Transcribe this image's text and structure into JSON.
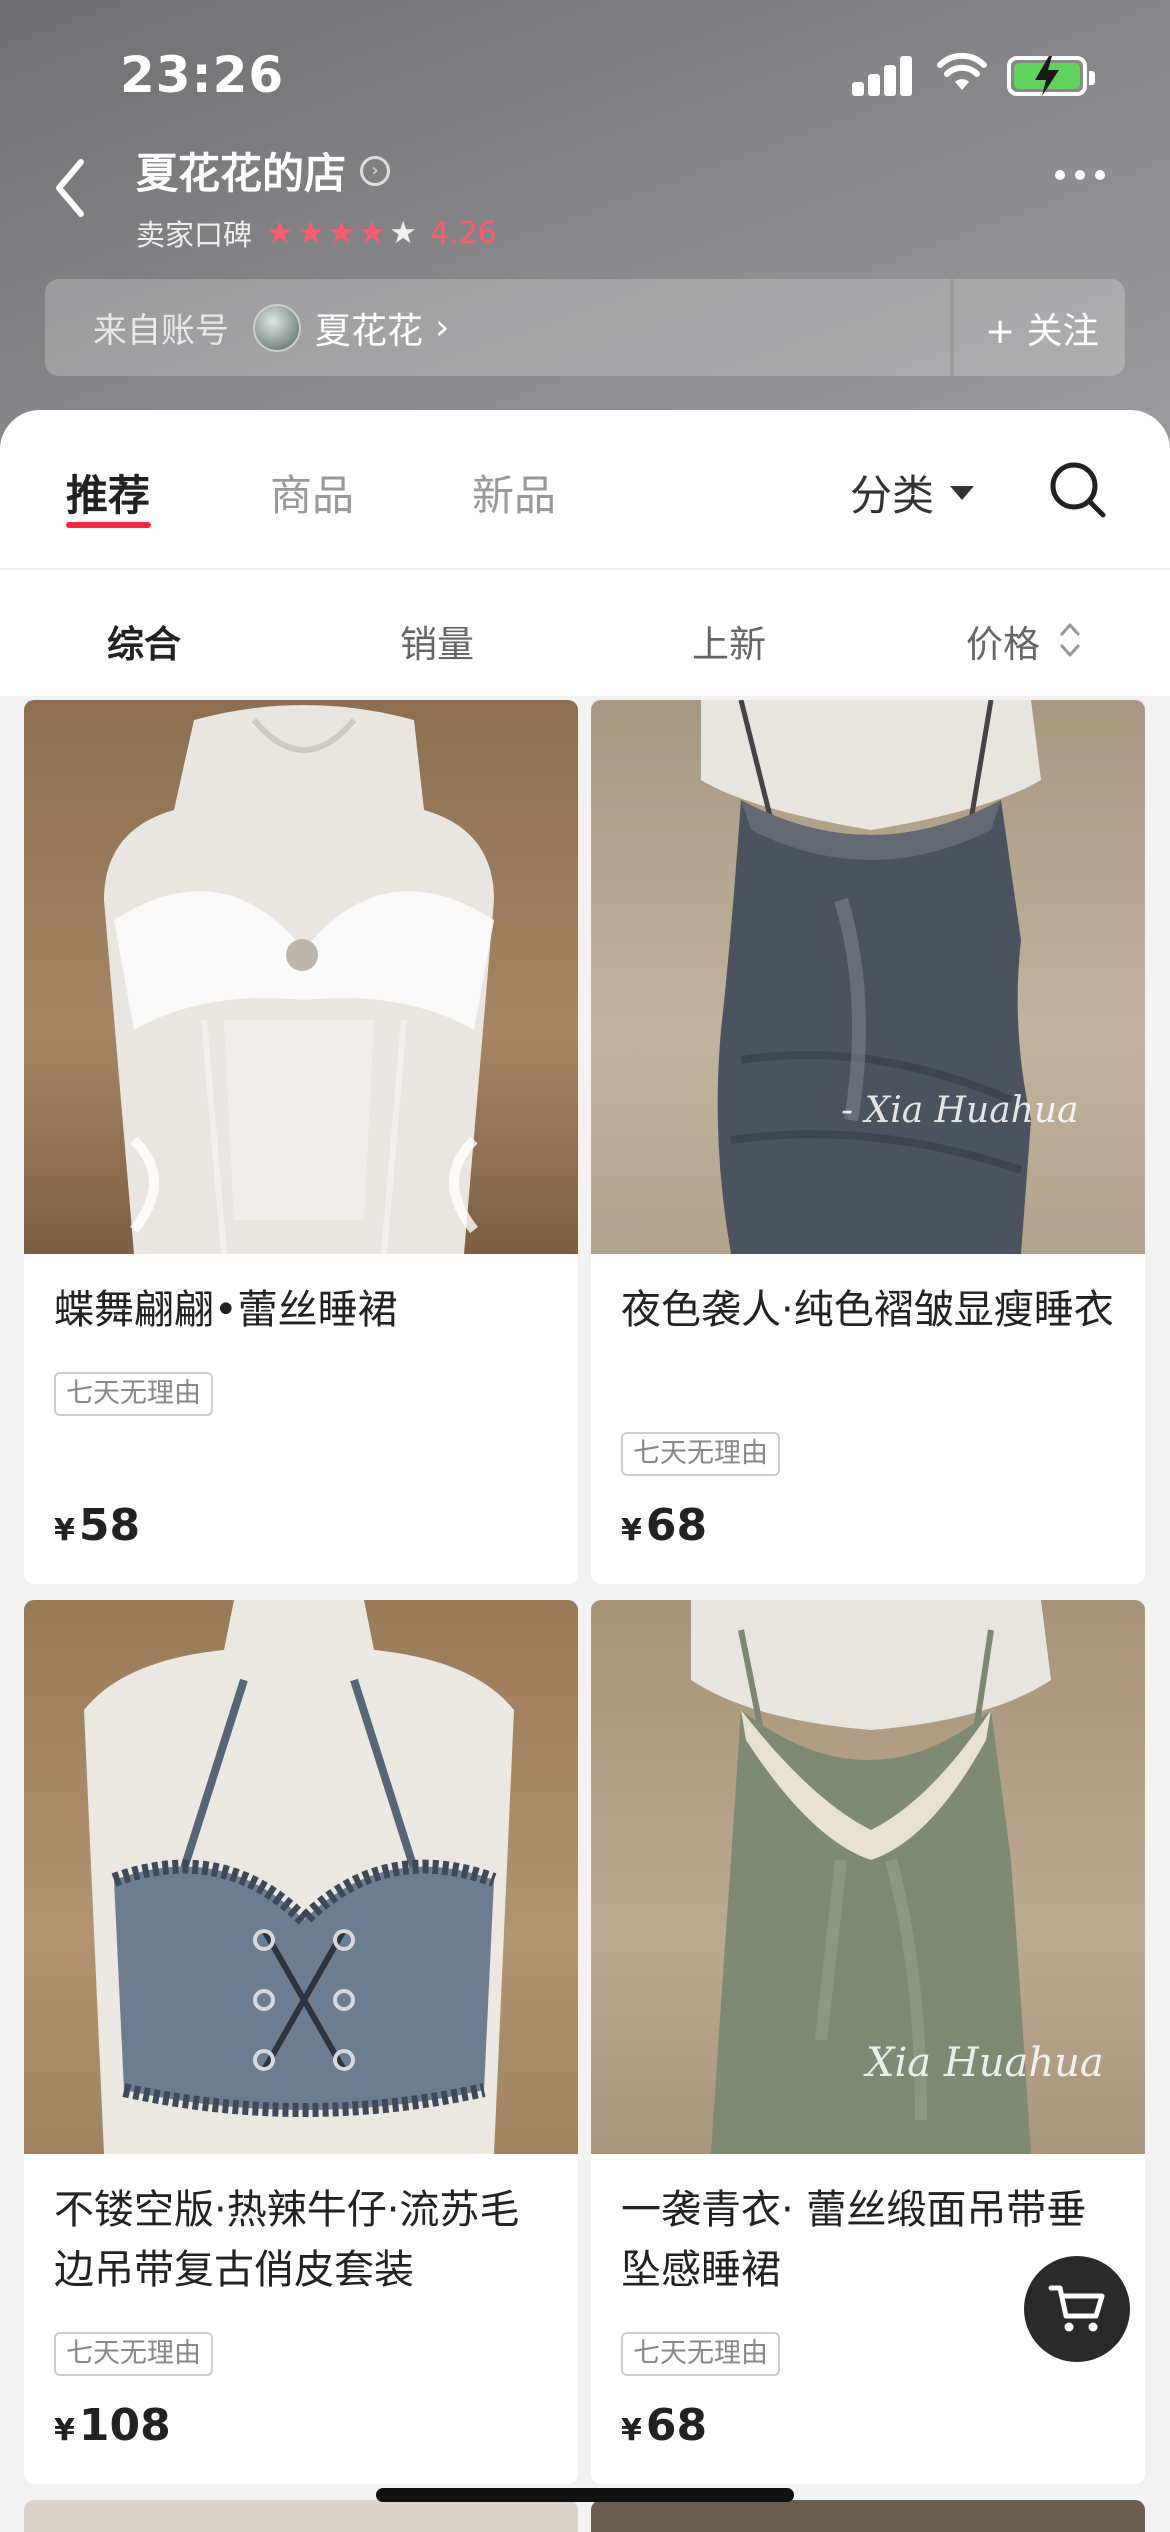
{
  "status_bar": {
    "time": "23:26"
  },
  "header": {
    "shop_name": "夏花花的店",
    "rating_label": "卖家口碑",
    "rating_score": "4.26",
    "rating_stars": 4.26,
    "account_from_label": "来自账号",
    "account_name": "夏花花",
    "follow_label": "+ 关注"
  },
  "tabs": [
    {
      "label": "推荐",
      "active": true
    },
    {
      "label": "商品",
      "active": false
    },
    {
      "label": "新品",
      "active": false
    }
  ],
  "category_label": "分类",
  "sort_options": [
    {
      "label": "综合",
      "active": true
    },
    {
      "label": "销量",
      "active": false
    },
    {
      "label": "上新",
      "active": false
    },
    {
      "label": "价格",
      "active": false
    }
  ],
  "products": [
    {
      "title": "蝶舞翩翩•蕾丝睡裙",
      "tag": "七天无理由",
      "currency": "¥",
      "price": "58"
    },
    {
      "title": "夜色袭人·纯色褶皱显瘦睡衣",
      "tag": "七天无理由",
      "currency": "¥",
      "price": "68",
      "watermark": "- Xia Huahua"
    },
    {
      "title": "不镂空版·热辣牛仔·流苏毛边吊带复古俏皮套装",
      "tag": "七天无理由",
      "currency": "¥",
      "price": "108"
    },
    {
      "title": "一袭青衣· 蕾丝缎面吊带垂坠感睡裙",
      "tag": "七天无理由",
      "currency": "¥",
      "price": "68",
      "watermark": "Xia Huahua"
    }
  ],
  "colors": {
    "accent": "#ff2442",
    "star": "#ff5a6e"
  }
}
